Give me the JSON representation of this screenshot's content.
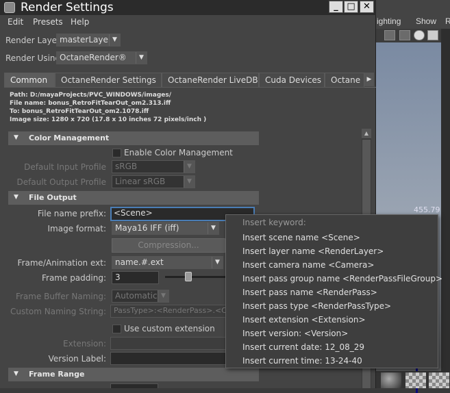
{
  "window": {
    "title": "Render Settings",
    "minimize": "_",
    "maximize": "□",
    "close": "✕"
  },
  "menu": [
    "Edit",
    "Presets",
    "Help"
  ],
  "render_layer": {
    "label": "Render Layer",
    "value": "masterLayer"
  },
  "render_using": {
    "label": "Render Using",
    "value": "OctaneRender®"
  },
  "tabs": [
    "Common",
    "OctaneRender Settings",
    "OctaneRender LiveDB",
    "Cuda Devices",
    "Octane"
  ],
  "path_info": {
    "path": "Path: D:/mayaProjects/PVC_WINDOWS/images/",
    "file_name": "File name:  bonus_RetroFitTearOut_om2.313.iff",
    "to": "To:          bonus_RetroFitTearOut_om2.1078.iff",
    "image_size": "Image size: 1280 x 720 (17.8 x 10 inches 72 pixels/inch )"
  },
  "color_management": {
    "header": "Color Management",
    "enable_label": "Enable Color Management",
    "input_label": "Default Input Profile",
    "input_value": "sRGB",
    "output_label": "Default Output Profile",
    "output_value": "Linear sRGB"
  },
  "file_output": {
    "header": "File Output",
    "prefix_label": "File name prefix:",
    "prefix_value": "<Scene>",
    "format_label": "Image format:",
    "format_value": "Maya16 IFF (iff)",
    "compression_label": "Compression...",
    "frame_ext_label": "Frame/Animation ext:",
    "frame_ext_value": "name.#.ext",
    "padding_label": "Frame padding:",
    "padding_value": "3",
    "buffer_label": "Frame Buffer Naming:",
    "buffer_value": "Automatic",
    "custom_label": "Custom Naming String:",
    "custom_value": "PassType>:<RenderPass>.<C",
    "use_custom_ext_label": "Use custom extension",
    "extension_label": "Extension:",
    "version_label": "Version Label:"
  },
  "frame_range": {
    "header": "Frame Range"
  },
  "popup": {
    "header": "Insert keyword:",
    "items": [
      "Insert scene name <Scene>",
      "Insert layer name <RenderLayer>",
      "Insert camera name <Camera>",
      "Insert pass group name <RenderPassFileGroup>",
      "Insert pass name <RenderPass>",
      "Insert pass type <RenderPassType>",
      "Insert extension <Extension>",
      "Insert version: <Version>",
      "Insert current date: 12_08_29",
      "Insert current time: 13-24-40"
    ]
  },
  "background": {
    "menu": [
      "ighting",
      "Show",
      "R"
    ],
    "coord": "455.79"
  }
}
